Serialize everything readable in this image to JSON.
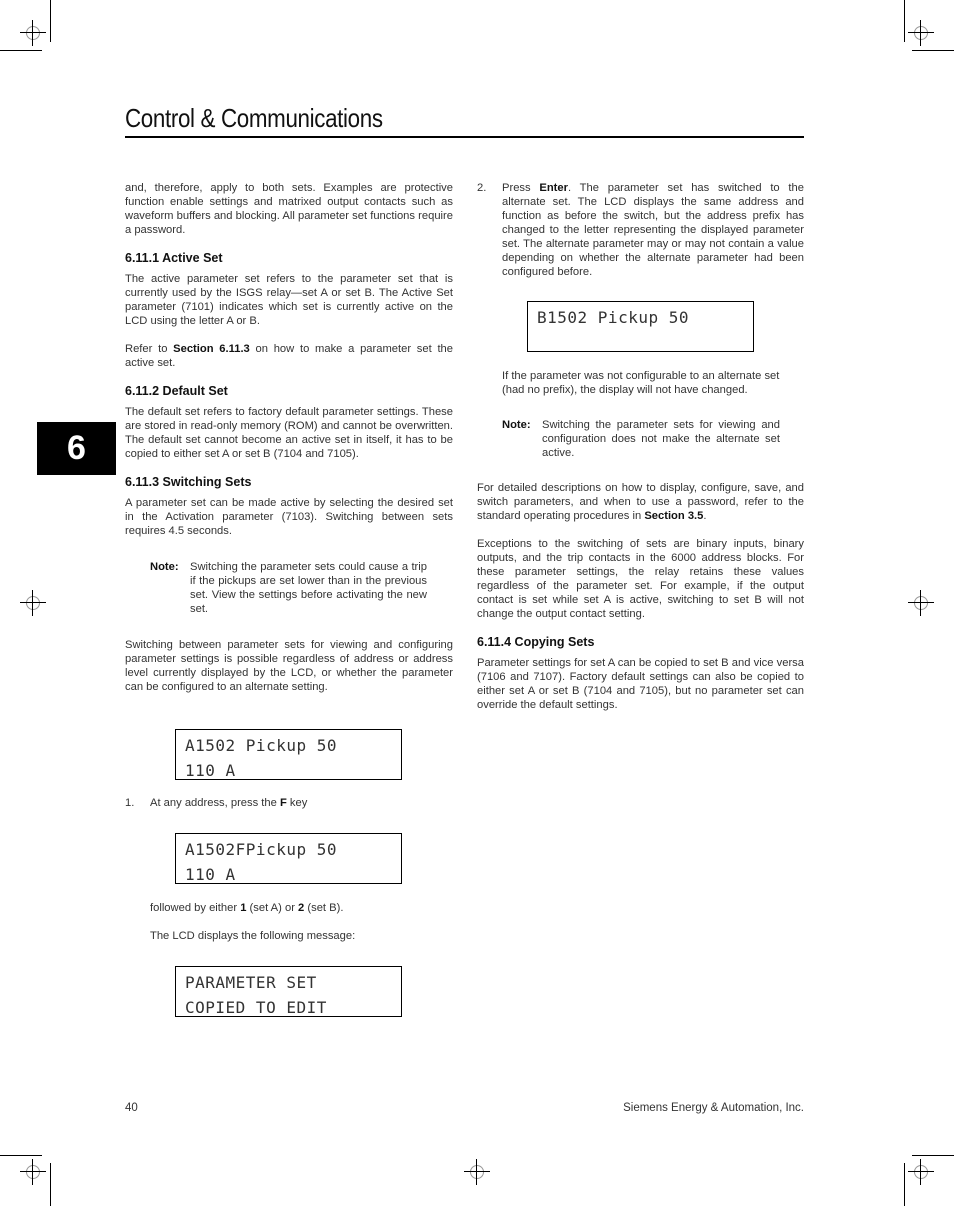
{
  "header": {
    "title": "Control & Communications"
  },
  "chapter_tab": "6",
  "left_column": {
    "intro": "and, therefore, apply to both sets. Examples are protective function enable settings and matrixed output contacts such as waveform buffers and blocking. All parameter set functions require a password.",
    "s6111": {
      "heading": "6.11.1  Active Set",
      "para1": "The active parameter set refers to the parameter set that is currently used by the ISGS relay—set A or set B. The Active Set parameter (7101) indicates which set is currently active on the LCD using the letter A or B.",
      "para2_pre": "Refer to ",
      "para2_bold": "Section 6.11.3",
      "para2_post": " on how to make a parameter set the active set."
    },
    "s6112": {
      "heading": "6.11.2  Default Set",
      "para": "The default set refers to factory default parameter settings. These are stored in read-only memory (ROM) and cannot be overwritten. The default set cannot become an active set in itself, it has to be copied to either set A or set B (7104 and 7105)."
    },
    "s6113": {
      "heading": "6.11.3  Switching Sets",
      "para": "A parameter set can be made active by selecting the desired set in the Activation parameter (7103). Switching between sets requires 4.5 seconds.",
      "note_label": "Note:",
      "note_text": "Switching the parameter sets could cause a trip if the pickups are set lower than in the previous set. View the settings before activating the new set.",
      "para2": "Switching between parameter sets for viewing and configuring parameter settings is possible regardless of address or address level currently displayed by the LCD, or whether the parameter can be configured to an alternate setting."
    },
    "lcd1": {
      "line1": "A1502 Pickup 50",
      "line2": "110 A"
    },
    "step1": {
      "num": "1.",
      "pre": "At any address, press the ",
      "bold": "F",
      "post": " key"
    },
    "lcd2": {
      "line1": "A1502FPickup 50",
      "line2": "110 A"
    },
    "followed": {
      "pre": "followed by either ",
      "b1": "1",
      "mid": " (set A) or ",
      "b2": "2",
      "post": " (set B)."
    },
    "lcd_msg": "The LCD displays the following message:",
    "lcd3": {
      "line1": "PARAMETER SET",
      "line2": "COPIED TO EDIT"
    }
  },
  "right_column": {
    "step2": {
      "num": "2.",
      "pre": "Press ",
      "bold": "Enter",
      "post": ". The parameter set has switched to the alternate set. The LCD displays the same address and function as before the switch, but the address prefix has changed to the letter representing the displayed parameter set. The alternate parameter may or may not contain a value depending on whether the alternate parameter had been configured before."
    },
    "lcd4": {
      "line1": "B1502 Pickup 50",
      "line2": ""
    },
    "no_prefix": "If the parameter was not configurable to an alternate set (had no prefix), the display will not have changed.",
    "note_label": "Note:",
    "note_text": "Switching the parameter sets for viewing and configuration does not make the alternate set active.",
    "detailed_pre": "For detailed descriptions on how to display, configure, save, and switch parameters, and when to use a password, refer to the standard operating procedures in ",
    "detailed_bold": "Section 3.5",
    "detailed_post": ".",
    "exceptions": "Exceptions to the switching of sets are binary inputs, binary outputs, and the trip contacts in the 6000 address blocks. For these parameter settings, the relay retains these values regardless of the parameter set. For example, if the output contact is set while set A is active, switching to set B will not change the output contact setting.",
    "s6114": {
      "heading": "6.11.4  Copying Sets",
      "para": "Parameter settings for set A can be copied to set B and vice versa (7106 and 7107). Factory default settings can also be copied to either set A or set B (7104 and 7105), but no parameter set can override the default settings."
    }
  },
  "footer": {
    "page_number": "40",
    "company": "Siemens Energy & Automation, Inc."
  }
}
